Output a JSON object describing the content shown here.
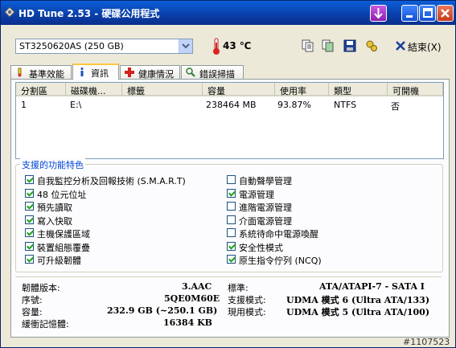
{
  "window": {
    "title": "HD Tune 2.53 - 硬碟公用程式"
  },
  "toolbar": {
    "drive": "ST3250620AS (250 GB)",
    "temperature": "43 ℃",
    "exit_label": "結束(X)",
    "icons": [
      "copy-text-icon",
      "copy-screenshot-icon",
      "save-icon",
      "options-icon"
    ]
  },
  "tabs": [
    {
      "label": "基準效能",
      "icon": "benchmark-icon"
    },
    {
      "label": "資訊",
      "icon": "info-icon"
    },
    {
      "label": "健康情況",
      "icon": "health-icon"
    },
    {
      "label": "錯誤掃描",
      "icon": "scan-icon"
    }
  ],
  "partition_table": {
    "headers": [
      "分割區",
      "磁碟機...",
      "標籤",
      "容量",
      "使用率",
      "類型",
      "可開機"
    ],
    "rows": [
      {
        "partition": "1",
        "drive": "E:\\",
        "label": "",
        "capacity": "238464 MB",
        "usage": "93.87%",
        "type": "NTFS",
        "bootable": "否"
      }
    ]
  },
  "features": {
    "title": "支援的功能特色",
    "left": [
      {
        "label": "自我監控分析及回報技術 (S.M.A.R.T)",
        "checked": true
      },
      {
        "label": "48 位元位址",
        "checked": true
      },
      {
        "label": "預先讀取",
        "checked": true
      },
      {
        "label": "寫入快取",
        "checked": true
      },
      {
        "label": "主機保護區域",
        "checked": true
      },
      {
        "label": "裝置組態覆疊",
        "checked": true
      },
      {
        "label": "可升級韌體",
        "checked": true
      }
    ],
    "right": [
      {
        "label": "自動聲學管理",
        "checked": false
      },
      {
        "label": "電源管理",
        "checked": true
      },
      {
        "label": "進階電源管理",
        "checked": false
      },
      {
        "label": "介面電源管理",
        "checked": false
      },
      {
        "label": "系統待命中電源喚醒",
        "checked": false
      },
      {
        "label": "安全性模式",
        "checked": true
      },
      {
        "label": "原生指令佇列 (NCQ)",
        "checked": true
      }
    ]
  },
  "info": {
    "firmware_label": "韌體版本:",
    "firmware": "3.AAC",
    "serial_label": "序號:",
    "serial": "5QE0M60E",
    "capacity_label": "容量:",
    "capacity": "232.9 GB (~250.1 GB)",
    "buffer_label": "緩衝記憶體:",
    "buffer": "16384 KB",
    "standard_label": "標準:",
    "standard": "ATA/ATAPI-7 - SATA I",
    "supported_mode_label": "支援模式:",
    "supported_mode": "UDMA 模式 6 (Ultra ATA/133)",
    "current_mode_label": "現用模式:",
    "current_mode": "UDMA 模式 5 (Ultra ATA/100)"
  },
  "watermark": "#1107523"
}
